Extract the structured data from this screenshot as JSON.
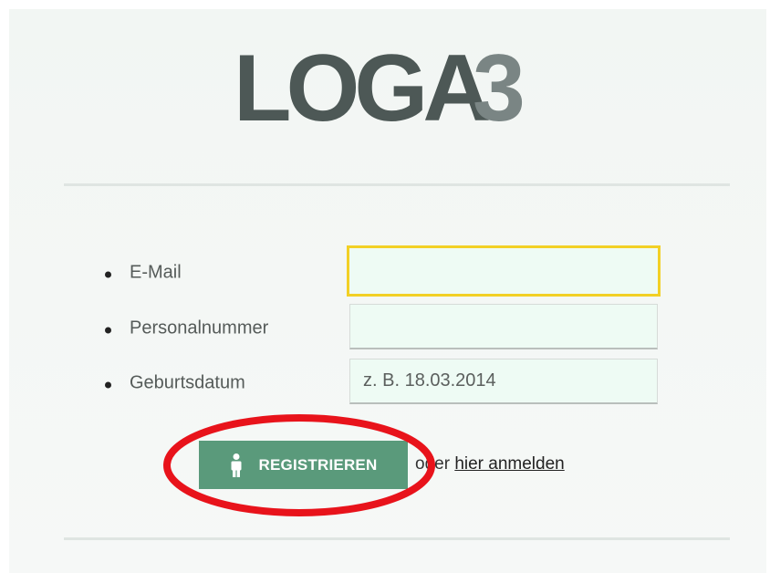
{
  "logo": {
    "text_main": "LOGA",
    "text_accent": "3",
    "color_main": "#4d5856",
    "color_accent": "#7a8584"
  },
  "form": {
    "email_label": "E-Mail",
    "email_value": "",
    "personal_label": "Personalnummer",
    "personal_value": "",
    "birth_label": "Geburtsdatum",
    "birth_placeholder": "z. B. 18.03.2014"
  },
  "actions": {
    "register_label": "REGISTRIEREN",
    "or_text": "oder",
    "login_link": "hier anmelden",
    "register_icon": "person-icon"
  },
  "colors": {
    "accent": "#5a9a7b",
    "focus": "#f2d025",
    "highlight": "#e8131b",
    "input_bg": "#eefbf4"
  }
}
